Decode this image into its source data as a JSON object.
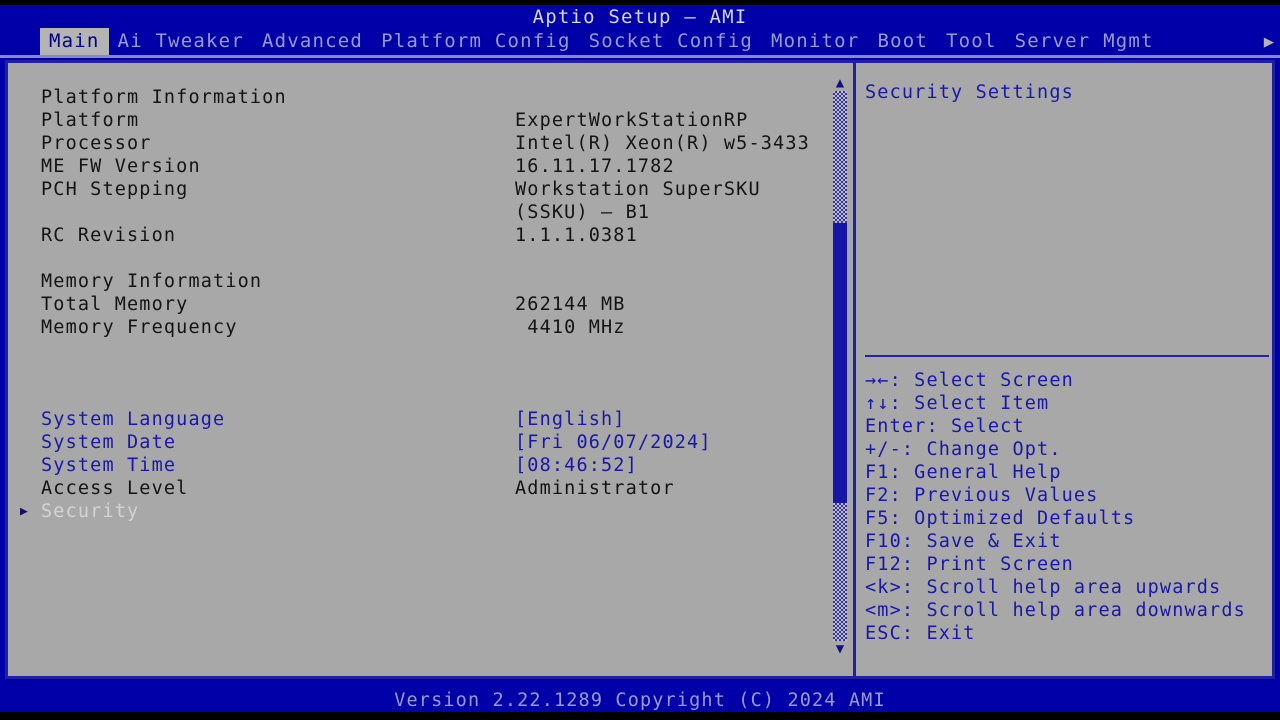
{
  "window": {
    "title": "Aptio Setup – AMI"
  },
  "menu": {
    "items": [
      {
        "label": "Main",
        "active": true
      },
      {
        "label": "Ai Tweaker",
        "active": false
      },
      {
        "label": "Advanced",
        "active": false
      },
      {
        "label": "Platform Config",
        "active": false
      },
      {
        "label": "Socket Config",
        "active": false
      },
      {
        "label": "Monitor",
        "active": false
      },
      {
        "label": "Boot",
        "active": false
      },
      {
        "label": "Tool",
        "active": false
      },
      {
        "label": "Server Mgmt",
        "active": false
      }
    ],
    "more_arrow": "▶"
  },
  "main": {
    "rows": [
      {
        "label": "Platform Information",
        "value": "",
        "style": "dark",
        "arrow": false
      },
      {
        "label": "Platform",
        "value": "ExpertWorkStationRP",
        "style": "dark",
        "arrow": false
      },
      {
        "label": "Processor",
        "value": "Intel(R) Xeon(R) w5-3433",
        "style": "dark",
        "arrow": false
      },
      {
        "label": "ME FW Version",
        "value": "16.11.17.1782",
        "style": "dark",
        "arrow": false
      },
      {
        "label": "PCH Stepping",
        "value": "Workstation SuperSKU",
        "style": "dark",
        "arrow": false
      },
      {
        "label": "",
        "value": "(SSKU) – B1",
        "style": "dark",
        "arrow": false
      },
      {
        "label": "RC Revision",
        "value": "1.1.1.0381",
        "style": "dark",
        "arrow": false
      },
      {
        "label": "",
        "value": "",
        "style": "dark",
        "arrow": false
      },
      {
        "label": "Memory Information",
        "value": "",
        "style": "dark",
        "arrow": false
      },
      {
        "label": "Total Memory",
        "value": "262144 MB",
        "style": "dark",
        "arrow": false
      },
      {
        "label": "Memory Frequency",
        "value": " 4410 MHz",
        "style": "dark",
        "arrow": false
      },
      {
        "label": "",
        "value": "",
        "style": "dark",
        "arrow": false
      },
      {
        "label": "",
        "value": "",
        "style": "dark",
        "arrow": false
      },
      {
        "label": "",
        "value": "",
        "style": "dark",
        "arrow": false
      },
      {
        "label": "System Language",
        "value": "[English]",
        "style": "blue",
        "arrow": false
      },
      {
        "label": "System Date",
        "value": "[Fri 06/07/2024]",
        "style": "blue",
        "arrow": false
      },
      {
        "label": "System Time",
        "value": "[08:46:52]",
        "style": "blue",
        "arrow": false
      },
      {
        "label": "Access Level",
        "value": "Administrator",
        "style": "dark",
        "arrow": false
      },
      {
        "label": "Security",
        "value": "",
        "style": "selected",
        "arrow": true
      }
    ],
    "scrollbar": {
      "up_arrow": "▲",
      "down_arrow": "▼"
    }
  },
  "help": {
    "title": "Security Settings",
    "keys": [
      "→←: Select Screen",
      "↑↓: Select Item",
      "Enter: Select",
      "+/-: Change Opt.",
      "F1: General Help",
      "F2: Previous Values",
      "F5: Optimized Defaults",
      "F10: Save & Exit",
      "F12: Print Screen",
      "<k>: Scroll help area upwards",
      "<m>: Scroll help area downwards",
      "ESC: Exit"
    ]
  },
  "footer": {
    "text": "Version 2.22.1289 Copyright (C) 2024 AMI"
  },
  "colors": {
    "screen_blue": "#0000a8",
    "panel_gray": "#a8a8a8",
    "accent_blue": "#1818a8",
    "menu_text": "#9a9ad0",
    "active_tab_bg": "#b4b4b4",
    "selected_text": "#d4d4d4",
    "dark_text": "#141414"
  }
}
